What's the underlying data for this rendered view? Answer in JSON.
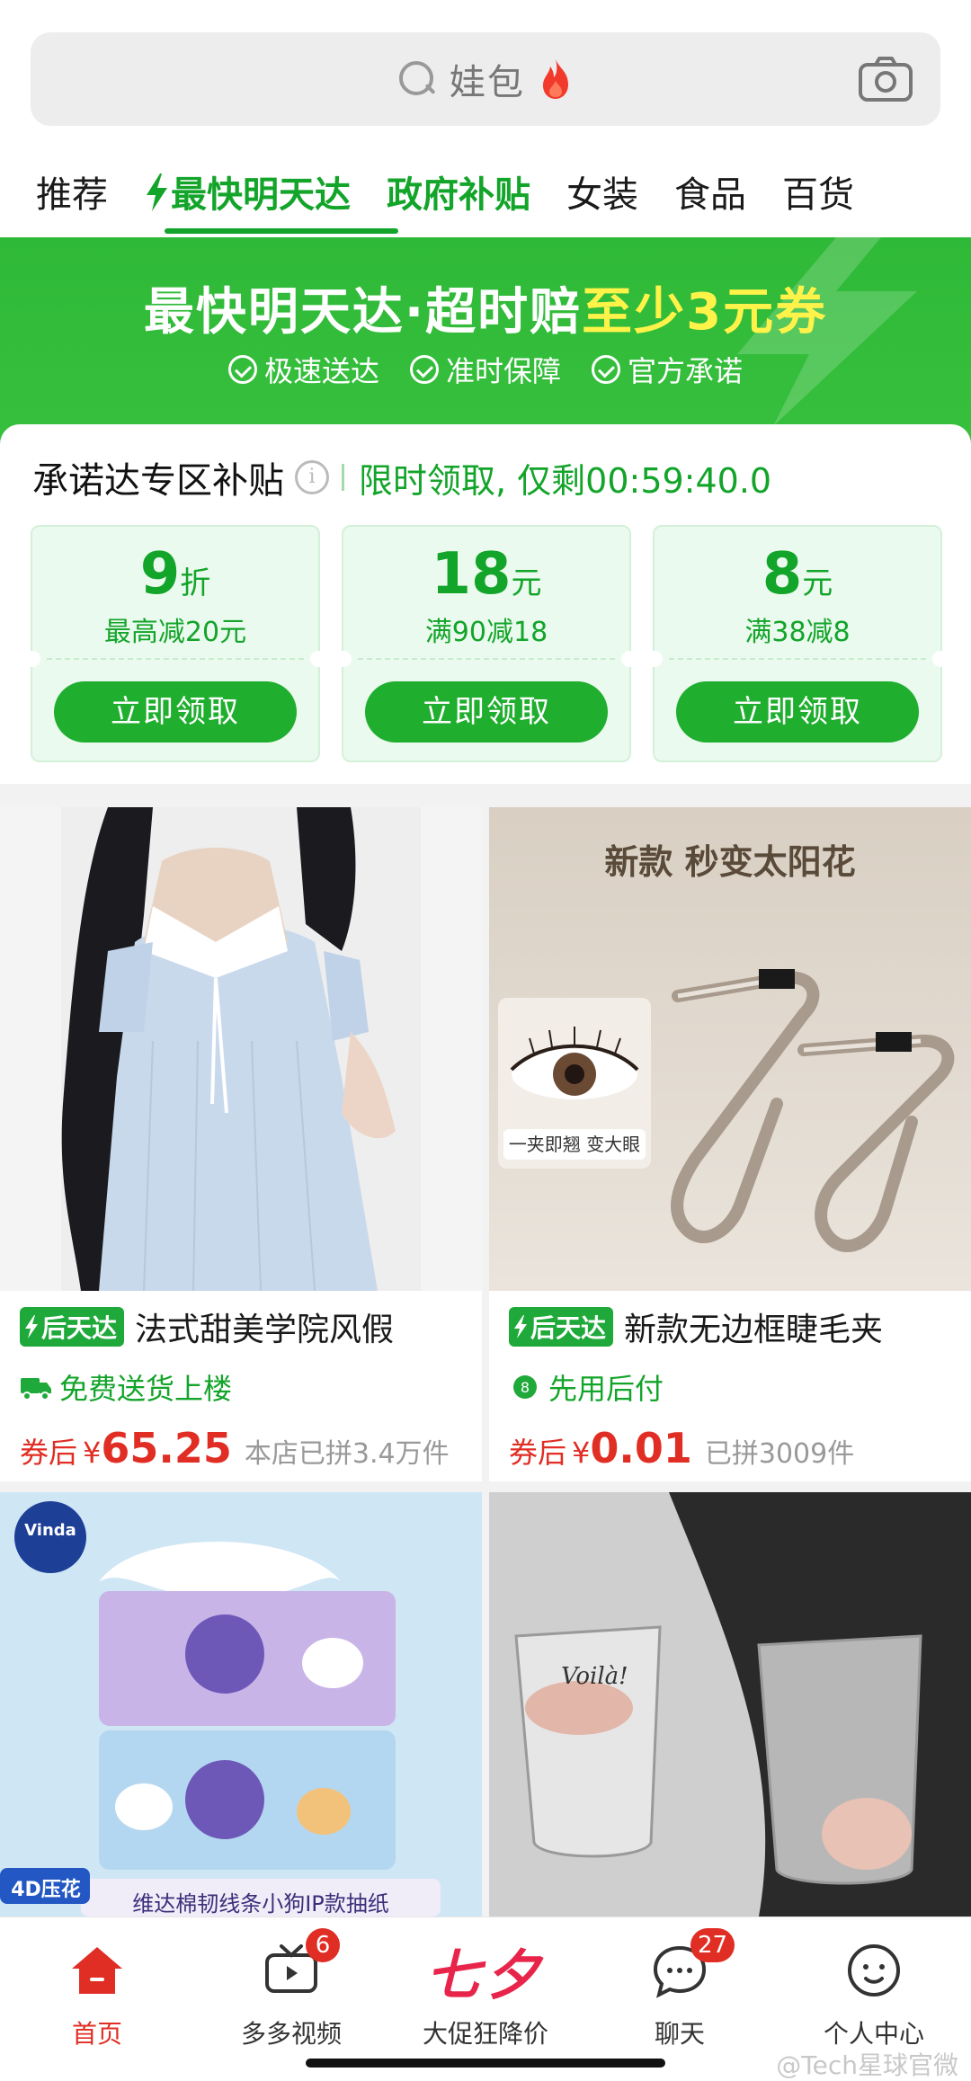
{
  "search": {
    "text": "娃包"
  },
  "tabs": [
    "推荐",
    "最快明天达",
    "政府补贴",
    "女装",
    "食品",
    "百货"
  ],
  "banner": {
    "title_main": "最快明天达·超时赔",
    "title_highlight": "至少3元券",
    "badges": [
      "极速送达",
      "准时保障",
      "官方承诺"
    ]
  },
  "subsidy": {
    "title": "承诺达专区补贴",
    "timer": "限时领取, 仅剩00:59:40.0",
    "coupons": [
      {
        "value": "9",
        "unit": "折",
        "desc": "最高减20元",
        "button": "立即领取"
      },
      {
        "value": "18",
        "unit": "元",
        "desc": "满90减18",
        "button": "立即领取"
      },
      {
        "value": "8",
        "unit": "元",
        "desc": "满38减8",
        "button": "立即领取"
      }
    ]
  },
  "products": [
    {
      "tag": "后天达",
      "title": "法式甜美学院风假",
      "feature": "免费送货上楼",
      "price_label": "券后",
      "yen": "¥",
      "price": "65.25",
      "sold": "本店已拼3.4万件"
    },
    {
      "tag": "后天达",
      "title": "新款无边框睫毛夹",
      "feature": "先用后付",
      "price_label": "券后",
      "yen": "¥",
      "price": "0.01",
      "sold": "已拼3009件",
      "image_headline": "新款 秒变太阳花",
      "image_caption": "一夹即翘 变大眼"
    },
    {
      "image_brand": "Vinda",
      "image_badge": "4D压花",
      "image_caption": "维达棉韧线条小狗IP款抽纸"
    },
    {
      "image_text": "Voilà!"
    }
  ],
  "bottom_nav": [
    {
      "label": "首页"
    },
    {
      "label": "多多视频",
      "badge": "6"
    },
    {
      "label": "大促狂降价",
      "promo": "七夕"
    },
    {
      "label": "聊天",
      "badge": "27"
    },
    {
      "label": "个人中心"
    }
  ],
  "watermark": "@Tech星球官微",
  "colors": {
    "accent_green": "#13a42a",
    "price_red": "#e02e24",
    "promo_pink": "#e8244b"
  }
}
